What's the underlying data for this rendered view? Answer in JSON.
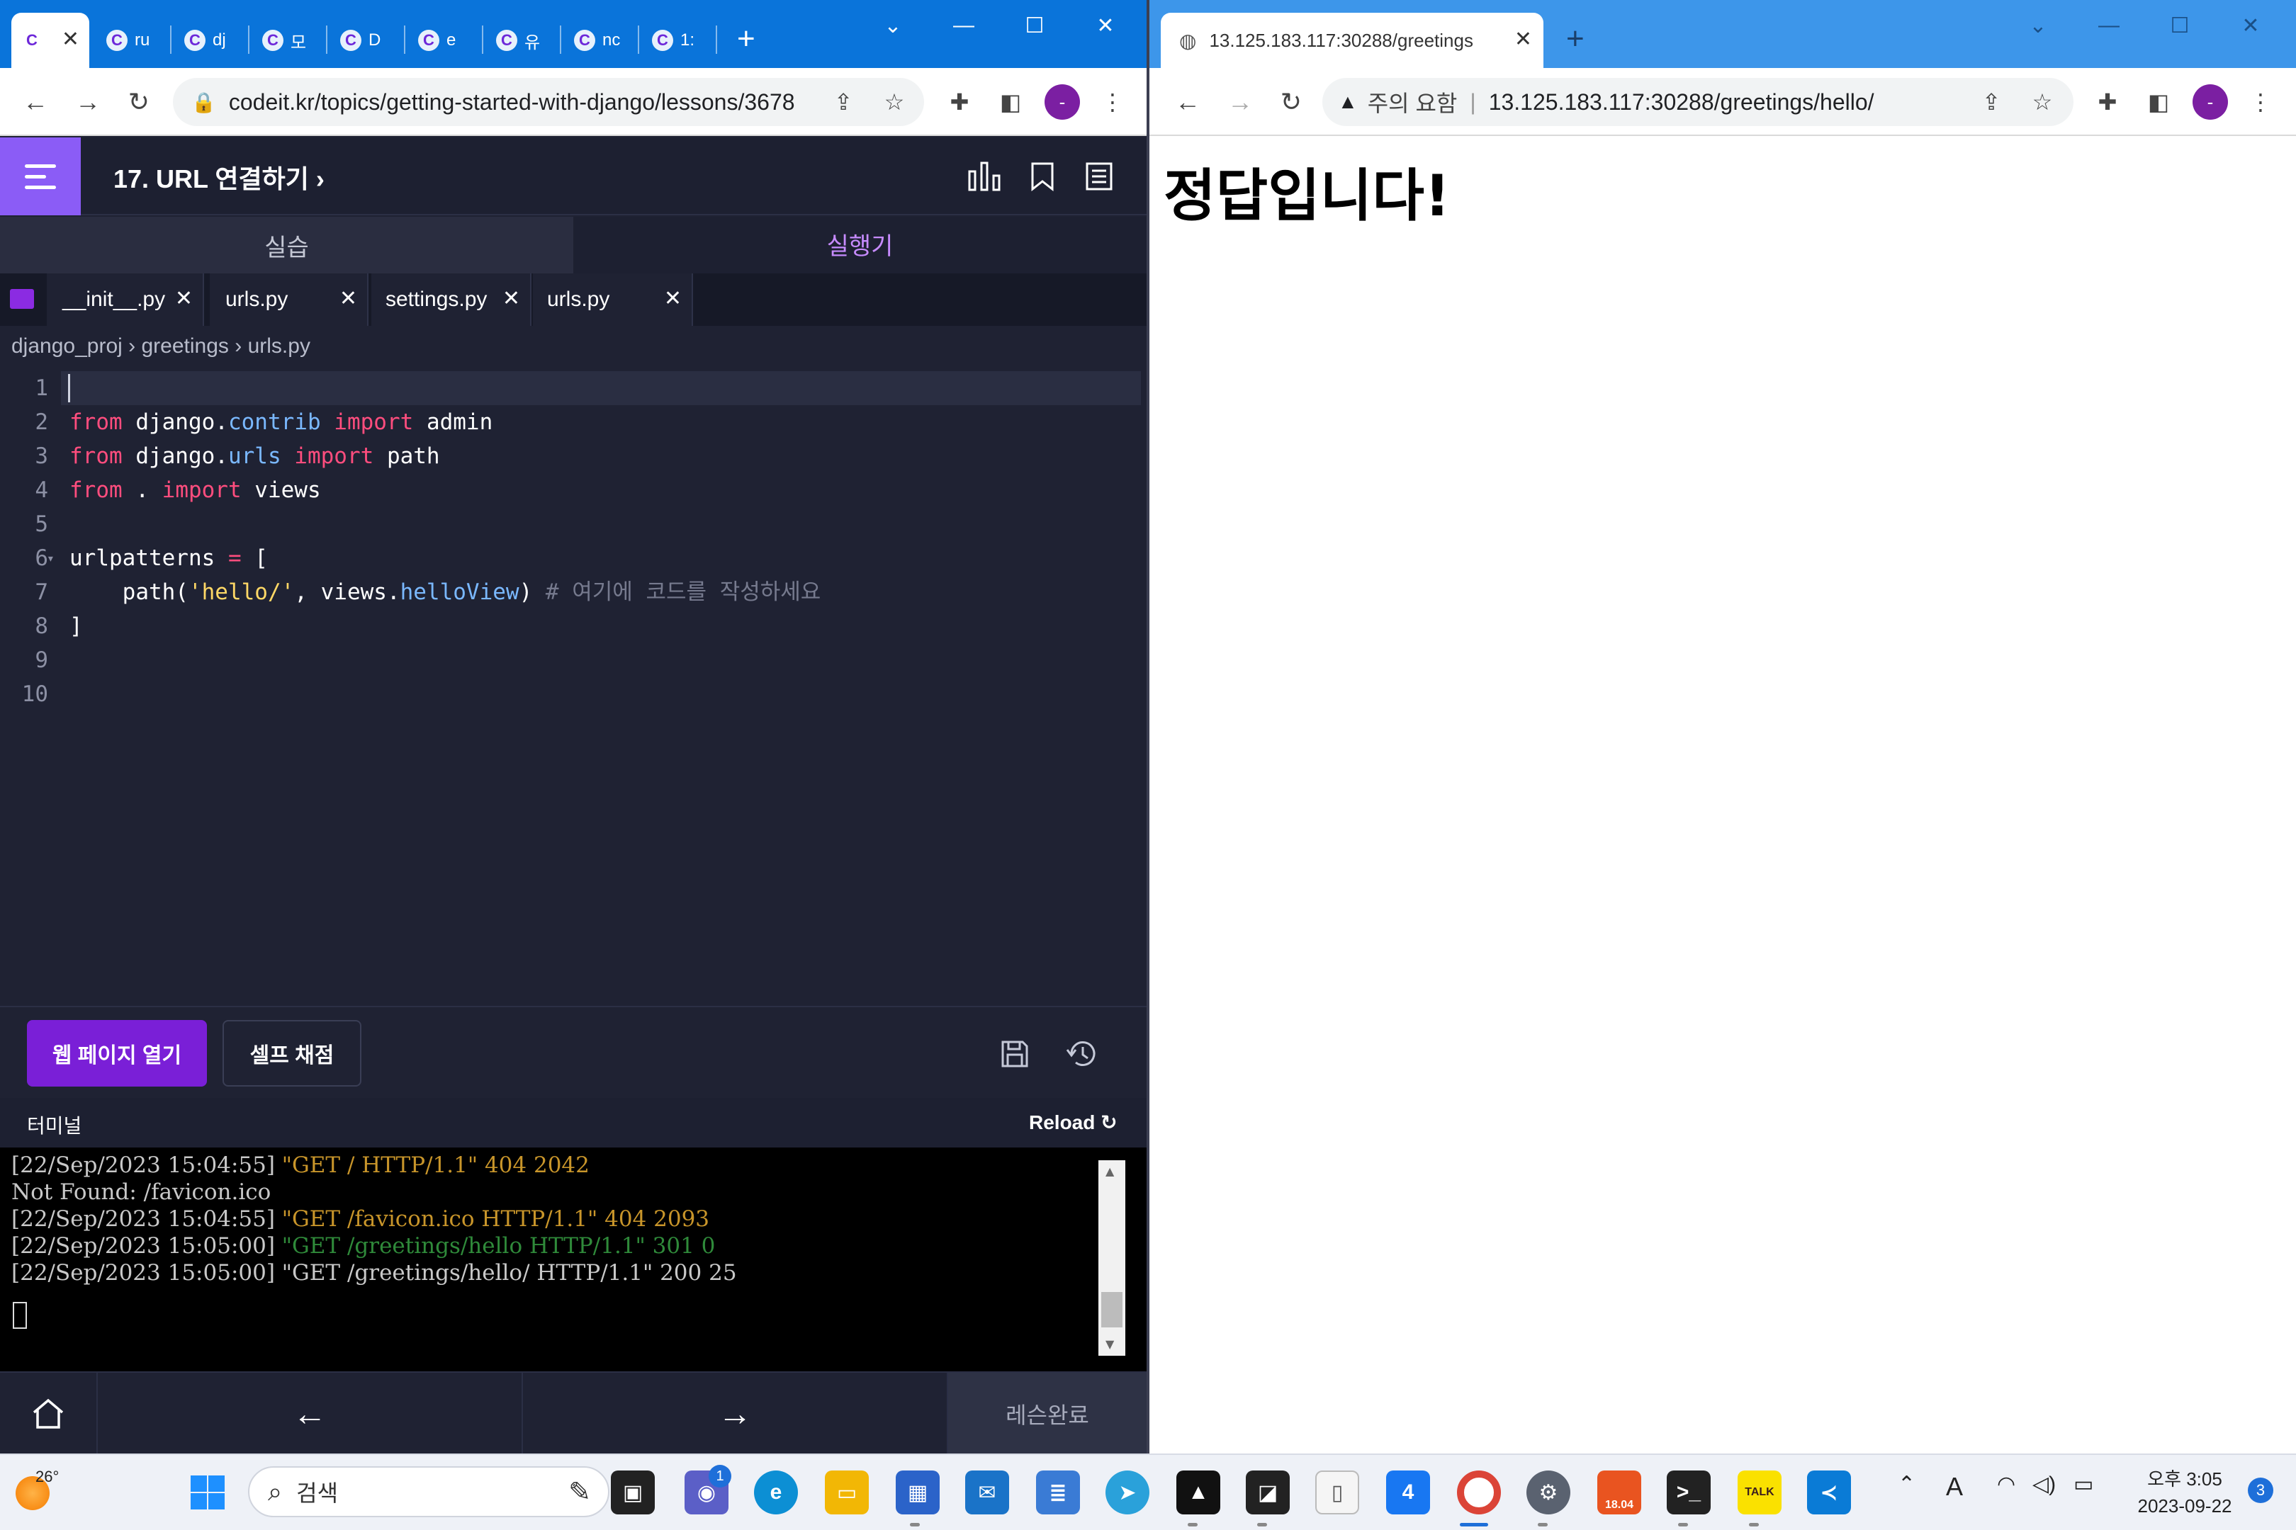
{
  "left_browser": {
    "tabs": [
      {
        "title": ""
      },
      {
        "title": "ru"
      },
      {
        "title": "dj"
      },
      {
        "title": "모"
      },
      {
        "title": "D"
      },
      {
        "title": "e"
      },
      {
        "title": "유"
      },
      {
        "title": "nc"
      },
      {
        "title": "1:"
      }
    ],
    "url": "codeit.kr/topics/getting-started-with-django/lessons/3678",
    "profile_initial": "-"
  },
  "app": {
    "lesson_title": "17. URL 연결하기",
    "mode_tabs": [
      {
        "label": "실습"
      },
      {
        "label": "실행기"
      }
    ],
    "file_tabs": [
      {
        "label": "__init__.py"
      },
      {
        "label": "urls.py"
      },
      {
        "label": "settings.py"
      },
      {
        "label": "urls.py"
      }
    ],
    "breadcrumb": [
      "django_proj",
      "greetings",
      "urls.py"
    ],
    "code_lines": [
      {
        "n": "1",
        "segments": []
      },
      {
        "n": "2",
        "segments": [
          {
            "t": "from",
            "c": "kw"
          },
          {
            "t": " django.",
            "c": ""
          },
          {
            "t": "contrib",
            "c": "attr"
          },
          {
            "t": " ",
            "c": ""
          },
          {
            "t": "import",
            "c": "kw"
          },
          {
            "t": " admin",
            "c": ""
          }
        ]
      },
      {
        "n": "3",
        "segments": [
          {
            "t": "from",
            "c": "kw"
          },
          {
            "t": " django.",
            "c": ""
          },
          {
            "t": "urls",
            "c": "attr"
          },
          {
            "t": " ",
            "c": ""
          },
          {
            "t": "import",
            "c": "kw"
          },
          {
            "t": " path",
            "c": ""
          }
        ]
      },
      {
        "n": "4",
        "segments": [
          {
            "t": "from",
            "c": "kw"
          },
          {
            "t": " . ",
            "c": ""
          },
          {
            "t": "import",
            "c": "kw"
          },
          {
            "t": " views",
            "c": ""
          }
        ]
      },
      {
        "n": "5",
        "segments": []
      },
      {
        "n": "6",
        "segments": [
          {
            "t": "urlpatterns ",
            "c": ""
          },
          {
            "t": "=",
            "c": "kw"
          },
          {
            "t": " [",
            "c": ""
          }
        ]
      },
      {
        "n": "7",
        "segments": [
          {
            "t": "    path(",
            "c": ""
          },
          {
            "t": "'hello/'",
            "c": "str"
          },
          {
            "t": ", views.",
            "c": ""
          },
          {
            "t": "helloView",
            "c": "attr"
          },
          {
            "t": ") ",
            "c": ""
          },
          {
            "t": "# 여기에 코드를 작성하세요",
            "c": "cmt"
          }
        ]
      },
      {
        "n": "8",
        "segments": [
          {
            "t": "]",
            "c": ""
          }
        ]
      },
      {
        "n": "9",
        "segments": []
      },
      {
        "n": "10",
        "segments": []
      }
    ],
    "open_web_label": "웹 페이지 열기",
    "self_grade_label": "셀프 채점",
    "terminal_label": "터미널",
    "reload_label": "Reload",
    "terminal_lines": [
      {
        "parts": [
          {
            "t": "[22/Sep/2023 15:04:55] ",
            "c": "#c8c8c8"
          },
          {
            "t": "\"GET / HTTP/1.1\" 404 2042",
            "c": "#c8952a"
          }
        ]
      },
      {
        "parts": [
          {
            "t": "Not Found: /favicon.ico",
            "c": "#c8c8c8"
          }
        ]
      },
      {
        "parts": [
          {
            "t": "[22/Sep/2023 15:04:55] ",
            "c": "#c8c8c8"
          },
          {
            "t": "\"GET /favicon.ico HTTP/1.1\" 404 2093",
            "c": "#c8952a"
          }
        ]
      },
      {
        "parts": [
          {
            "t": "[22/Sep/2023 15:05:00] ",
            "c": "#c8c8c8"
          },
          {
            "t": "\"GET /greetings/hello HTTP/1.1\" 301 0",
            "c": "#2f8a3a"
          }
        ]
      },
      {
        "parts": [
          {
            "t": "[22/Sep/2023 15:05:00] \"GET /greetings/hello/ HTTP/1.1\" 200 25",
            "c": "#c8c8c8"
          }
        ]
      }
    ],
    "complete_label": "레슨완료"
  },
  "right_browser": {
    "tab_title": "13.125.183.117:30288/greetings",
    "security_label": "주의 요함",
    "url": "13.125.183.117:30288/greetings/hello/",
    "page_text": "정답입니다!",
    "profile_initial": "-"
  },
  "taskbar": {
    "weather_temp": "26°",
    "search_placeholder": "검색",
    "chat_badge": "1",
    "ubuntu_version": "18.04",
    "kakao_label": "TALK",
    "time": "오후 3:05",
    "date": "2023-09-22",
    "notification_count": "3",
    "ime_label": "A"
  },
  "colors": {
    "accent": "#7a1fd7",
    "menu": "#8b5cf6",
    "active_mode": "#c78bff",
    "left_titlebar": "#0a74da",
    "right_titlebar": "#3d96ea"
  }
}
